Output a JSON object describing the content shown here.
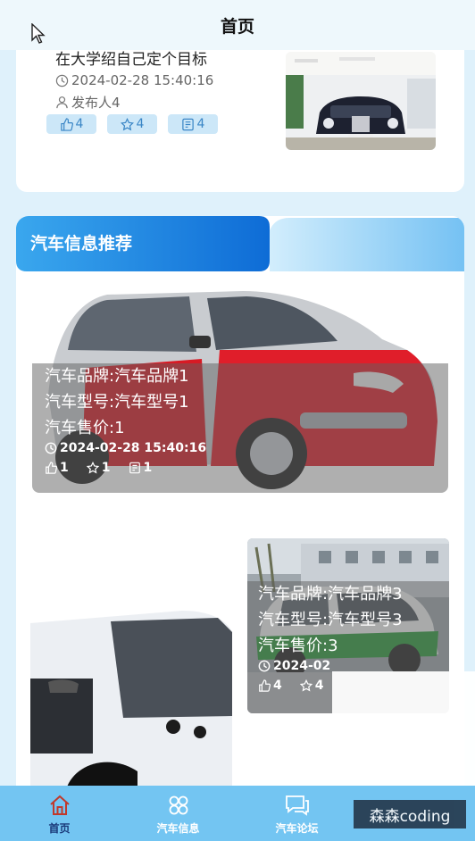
{
  "header": {
    "title": "首页"
  },
  "news_card": {
    "title": "在大学绍自己定个目标",
    "time": "2024-02-28 15:40:16",
    "publisher": "发布人4",
    "likes": "4",
    "favorites": "4",
    "comments": "4"
  },
  "section": {
    "title": "汽车信息推荐"
  },
  "cars": [
    {
      "brand": "汽车品牌:汽车品牌1",
      "model": "汽车型号:汽车型号1",
      "price": "汽车售价:1",
      "time": "2024-02-28 15:40:16",
      "likes": "1",
      "favorites": "1",
      "comments": "1"
    },
    {
      "brand": "汽车品牌:汽车品牌3",
      "model": "汽车型号:汽车型号3",
      "price": "汽车售价:3",
      "time": "2024-02",
      "likes": "4",
      "favorites": "4"
    }
  ],
  "nav": {
    "items": [
      {
        "label": "首页"
      },
      {
        "label": "汽车信息"
      },
      {
        "label": "汽车论坛"
      },
      {
        "label": ""
      }
    ]
  },
  "watermark": "森森coding",
  "colors": {
    "accent": "#2f8fd8",
    "nav_bg": "#73c5f2",
    "badge_bg": "#cce7f8",
    "section_gradient_start": "#3aa7ee"
  }
}
